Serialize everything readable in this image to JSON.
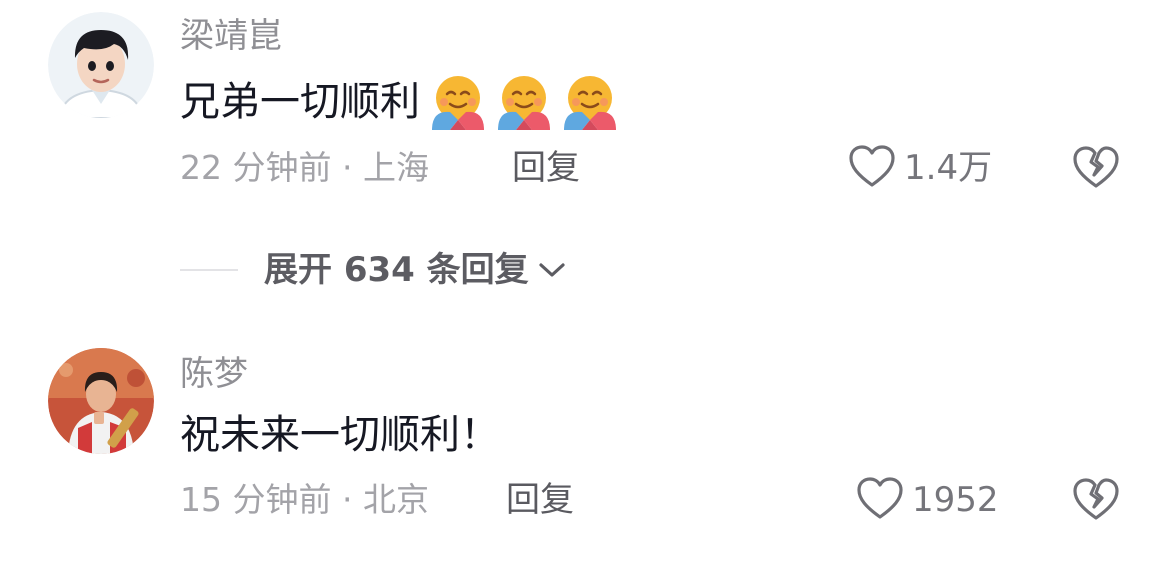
{
  "comments": [
    {
      "username": "梁靖崑",
      "text": "兄弟一切顺利",
      "emojis": [
        "hugging-face-emoji",
        "hugging-face-emoji",
        "hugging-face-emoji"
      ],
      "time_location": "22 分钟前 · 上海",
      "reply_label": "回复",
      "likes": "1.4万"
    },
    {
      "username": "陈梦",
      "text": "祝未来一切顺利！",
      "time_location": "15 分钟前 · 北京",
      "reply_label": "回复",
      "likes": "1952"
    }
  ],
  "expand_replies": {
    "label": "展开 634 条回复"
  },
  "colors": {
    "username": "#8f8f94",
    "text": "#161823",
    "meta": "#a3a3a8"
  }
}
